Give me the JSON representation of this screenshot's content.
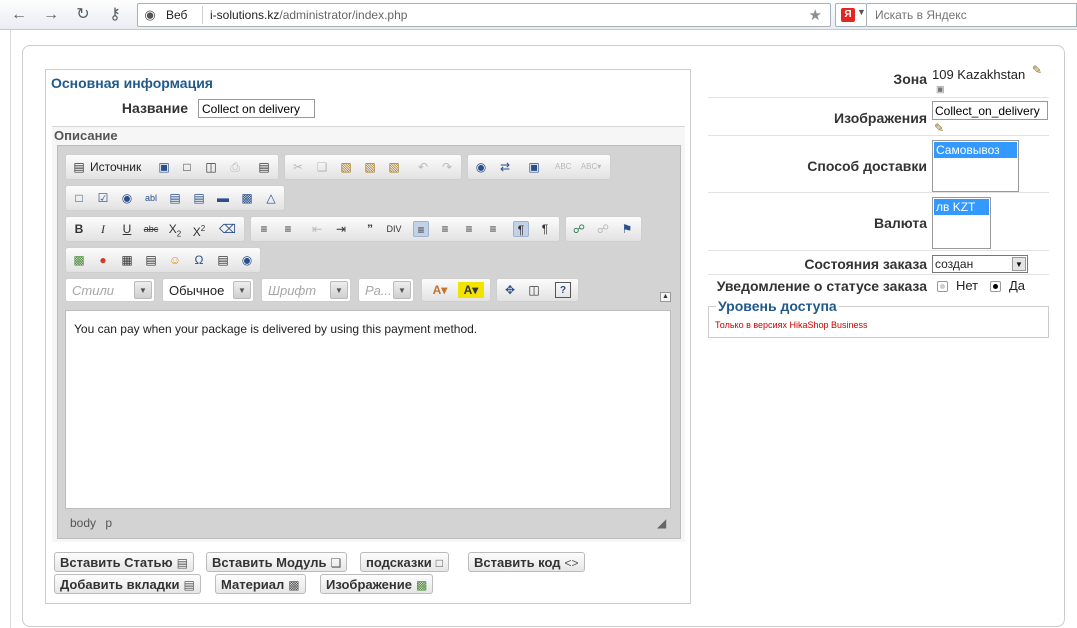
{
  "browser": {
    "web_label": "Веб",
    "url_host": "i-solutions.kz",
    "url_path": "/administrator/index.php",
    "search_placeholder": "Искать в Яндекс",
    "yandex_logo": "Я"
  },
  "main_info": {
    "title": "Основная информация",
    "name_label": "Название",
    "name_value": "Collect on delivery",
    "description_label": "Описание"
  },
  "editor": {
    "source_label": "Источник",
    "styles_placeholder": "Стили",
    "format_value": "Обычное",
    "font_placeholder": "Шрифт",
    "size_placeholder": "Ра...",
    "content": "You can pay when your package is delivered by using this payment method.",
    "status_path": "body p"
  },
  "buttons": {
    "insert_article": "Вставить Статью",
    "insert_module": "Вставить Модуль",
    "hints": "подсказки",
    "insert_code": "Вставить код",
    "add_tabs": "Добавить вкладки",
    "material": "Материал",
    "image": "Изображение"
  },
  "right": {
    "zone_label": "Зона",
    "zone_value": "109 Kazakhstan",
    "image_label": "Изображения",
    "image_value": "Collect_on_delivery",
    "shipping_label": "Способ доставки",
    "shipping_selected": "Самовывоз",
    "currency_label": "Валюта",
    "currency_selected": "лв KZT",
    "order_status_label": "Состояния заказа",
    "order_status_value": "создан",
    "notify_label": "Уведомление о статусе заказа",
    "notify_no": "Нет",
    "notify_yes": "Да",
    "notify_selected": "yes",
    "access_title": "Уровень доступа",
    "access_note": "Только в версиях HikaShop Business"
  },
  "colors": {
    "title_blue": "#1f5a8b",
    "selection_blue": "#3399ff",
    "note_red": "#cc0000"
  }
}
